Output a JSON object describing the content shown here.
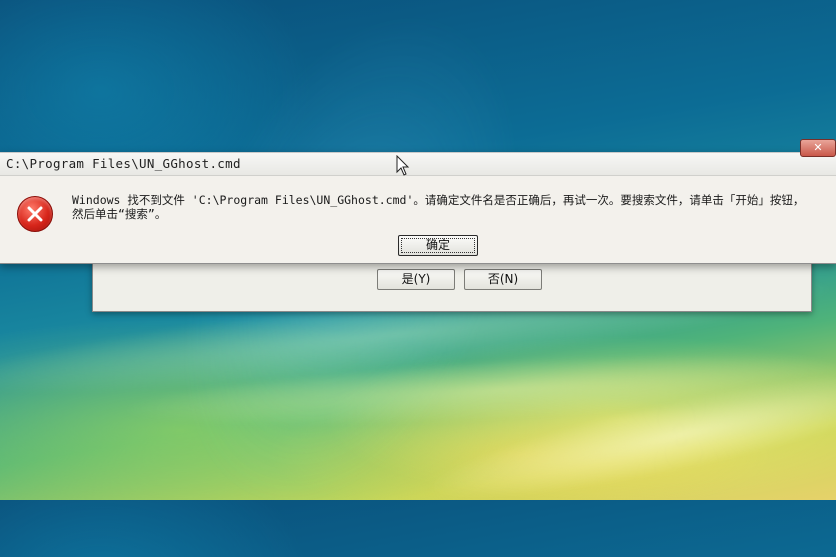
{
  "background_dialog": {
    "yes_label": "是(Y)",
    "no_label": "否(N)"
  },
  "error_dialog": {
    "title": "C:\\Program Files\\UN_GGhost.cmd",
    "close_label": "✕",
    "message_line1": "Windows 找不到文件 'C:\\Program Files\\UN_GGhost.cmd'。请确定文件名是否正确后，再试一次。要搜索文件，请单击「开始」按钮，",
    "message_line2": "然后单击“搜索”。",
    "ok_label": "确定",
    "icon": "error-x-icon"
  },
  "colors": {
    "error_red": "#d7261b",
    "dialog_bg": "#f3f1ec"
  }
}
